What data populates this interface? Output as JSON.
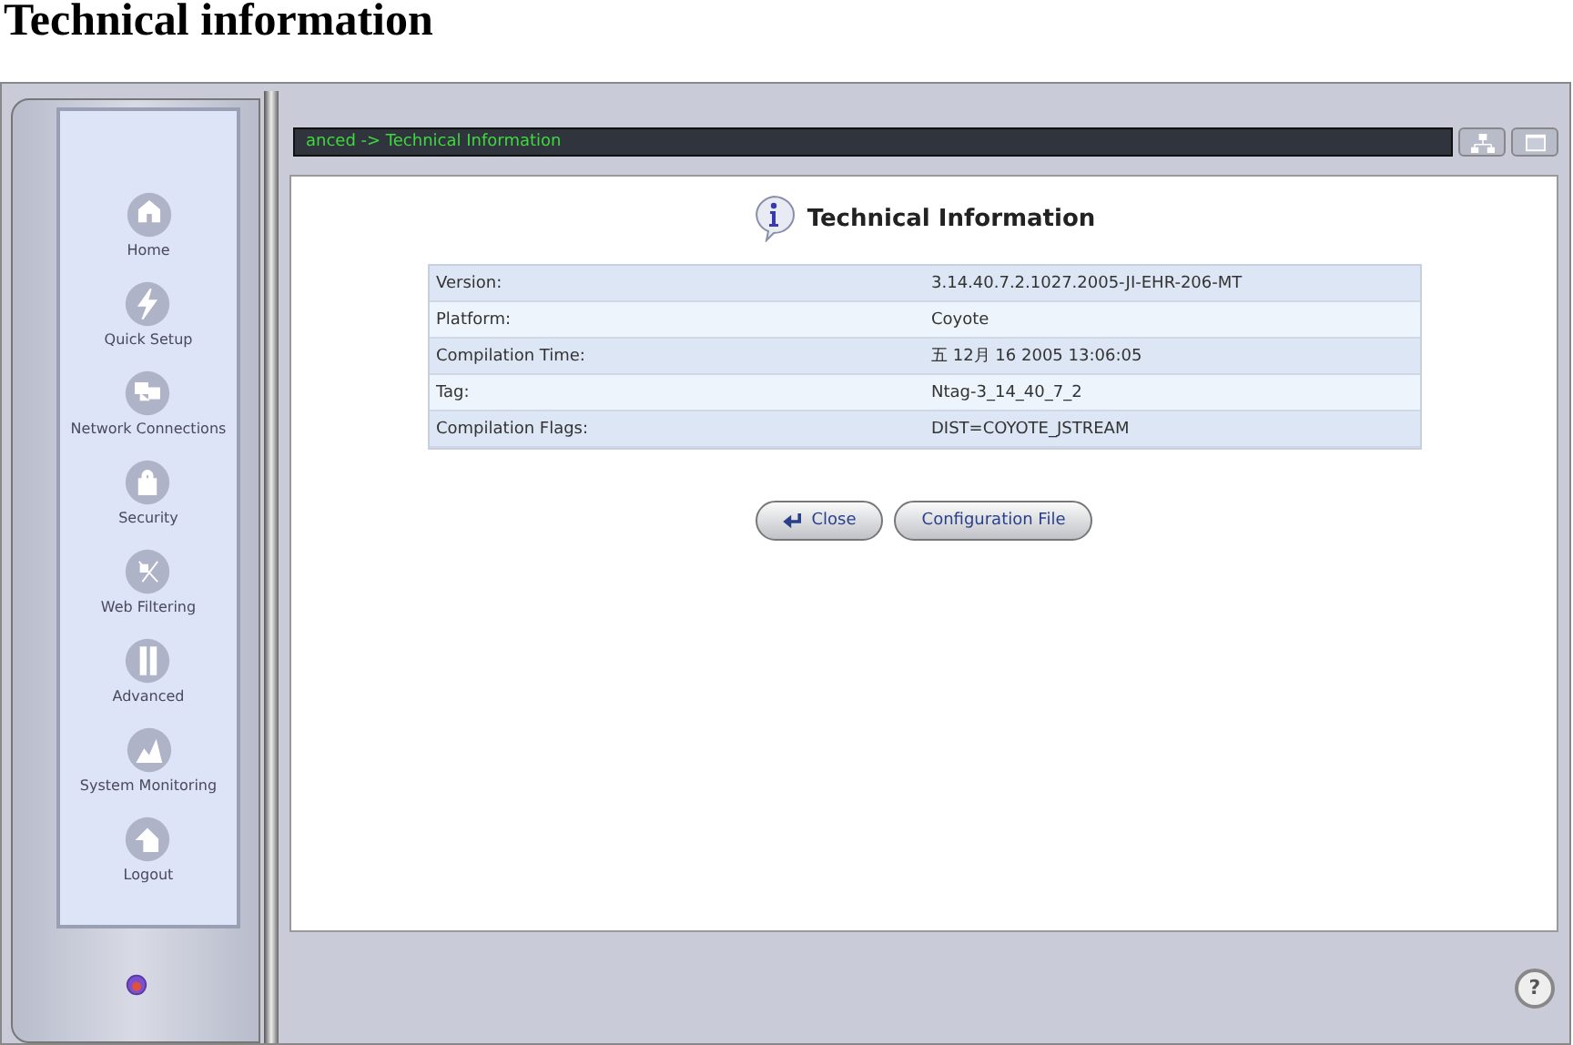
{
  "page_heading": "Technical information",
  "nav": [
    {
      "label": "Home"
    },
    {
      "label": "Quick Setup"
    },
    {
      "label": "Network Connections"
    },
    {
      "label": "Security"
    },
    {
      "label": "Web Filtering"
    },
    {
      "label": "Advanced"
    },
    {
      "label": "System Monitoring"
    },
    {
      "label": "Logout"
    }
  ],
  "breadcrumb": "anced -> Technical Information",
  "title": "Technical Information",
  "rows": [
    {
      "label": "Version:",
      "value": "3.14.40.7.2.1027.2005-JI-EHR-206-MT"
    },
    {
      "label": "Platform:",
      "value": "Coyote"
    },
    {
      "label": "Compilation Time:",
      "value": "五 12月 16 2005 13:06:05"
    },
    {
      "label": "Tag:",
      "value": "Ntag-3_14_40_7_2"
    },
    {
      "label": "Compilation Flags:",
      "value": "DIST=COYOTE_JSTREAM"
    }
  ],
  "buttons": [
    {
      "label": "Close",
      "kind": "back"
    },
    {
      "label": "Configuration File",
      "kind": "plain"
    }
  ],
  "help_button": "?"
}
